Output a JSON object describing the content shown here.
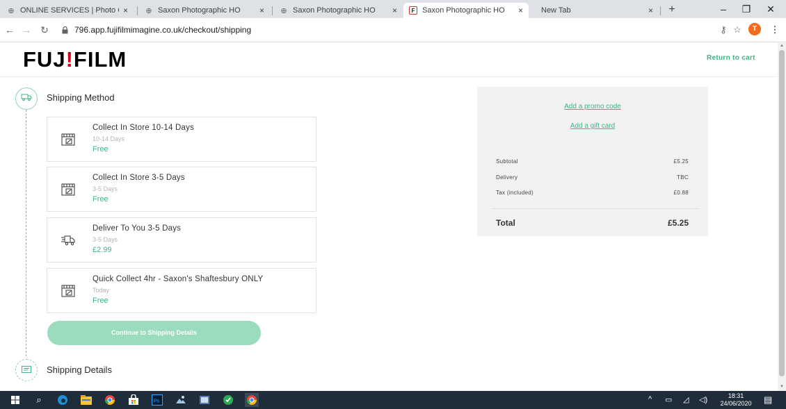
{
  "browser": {
    "tabs": [
      {
        "title": "ONLINE SERVICES | Photo Cen",
        "favicon": "globe-icon",
        "active": false
      },
      {
        "title": "Saxon Photographic HO",
        "favicon": "globe-icon",
        "active": false
      },
      {
        "title": "Saxon Photographic HO",
        "favicon": "globe-icon",
        "active": false
      },
      {
        "title": "Saxon Photographic HO",
        "favicon": "fujifilm-favicon",
        "active": true
      },
      {
        "title": "New Tab",
        "favicon": "none",
        "active": false
      }
    ],
    "close_glyph": "×",
    "new_tab_glyph": "+",
    "url": "796.app.fujifilmimagine.co.uk/checkout/shipping",
    "profile_initial": "T"
  },
  "header": {
    "logo_part1": "FUJ",
    "logo_mark": "!",
    "logo_part2": "FILM",
    "return_link": "Return to cart"
  },
  "steps": {
    "shipping_method_title": "Shipping Method",
    "shipping_details_title": "Shipping Details"
  },
  "shipping_options": [
    {
      "name": "Collect In Store 10-14 Days",
      "sub": "10-14 Days",
      "price": "Free",
      "icon": "store-calendar-icon"
    },
    {
      "name": "Collect In Store 3-5 Days",
      "sub": "3-5 Days",
      "price": "Free",
      "icon": "store-calendar-icon"
    },
    {
      "name": "Deliver To You 3-5 Days",
      "sub": "3-5 Days",
      "price": "£2.99",
      "icon": "delivery-truck-icon"
    },
    {
      "name": "Quick Collect 4hr - Saxon's Shaftesbury ONLY",
      "sub": "Today",
      "price": "Free",
      "icon": "store-calendar-icon"
    }
  ],
  "continue_button": "Continue to Shipping Details",
  "summary": {
    "promo_link": "Add a promo code",
    "gift_link": "Add a gift card",
    "subtotal_label": "Subtotal",
    "subtotal_value": "£5.25",
    "delivery_label": "Delivery",
    "delivery_value": "TBC",
    "tax_label": "Tax (included)",
    "tax_value": "£0.88",
    "total_label": "Total",
    "total_value": "£5.25"
  },
  "taskbar": {
    "time": "18:31",
    "date": "24/06/2020"
  },
  "colors": {
    "accent_green": "#3fb383",
    "button_green_disabled": "#9bdbbe",
    "logo_red": "#d6001c",
    "summary_bg": "#f2f2f2",
    "taskbar_bg": "#1f2d3a"
  }
}
